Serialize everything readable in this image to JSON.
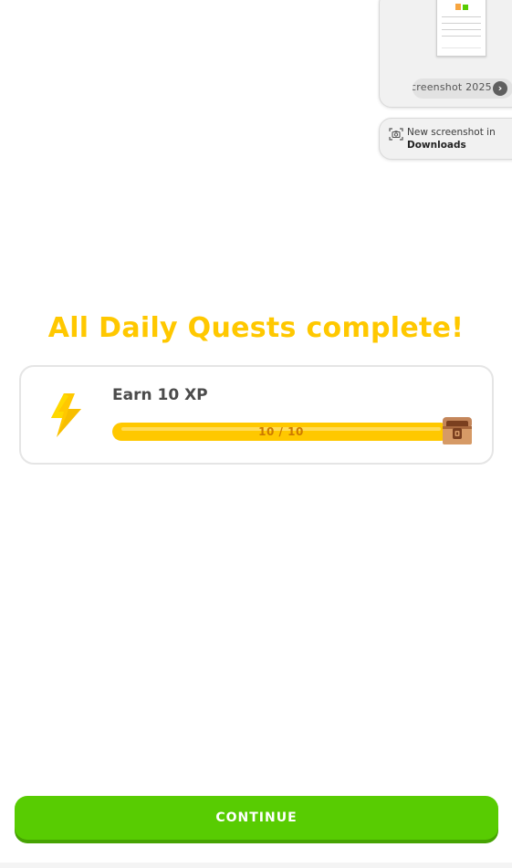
{
  "overlay": {
    "screenshot_name": "creenshot 2025",
    "notification_line1": "New screenshot in",
    "notification_line2": "Downloads"
  },
  "headline": "All Daily Quests complete!",
  "quest": {
    "title": "Earn 10 XP",
    "progress_text": "10 / 10",
    "progress_fraction": 1.0,
    "icon": "lightning-bolt-icon",
    "reward_icon": "treasure-chest-icon"
  },
  "continue_label": "CONTINUE",
  "colors": {
    "accent_yellow": "#ffc800",
    "progress_text": "#cd7900",
    "button_green": "#58cc02",
    "button_shadow": "#46a302",
    "title_gray": "#4b4b4b",
    "border_gray": "#e5e5e5"
  }
}
